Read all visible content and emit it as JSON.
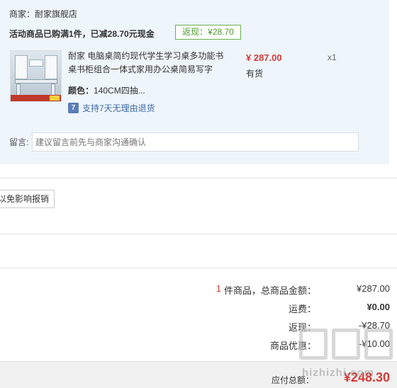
{
  "order": {
    "merchant": "商家：耐家旗舰店",
    "promo": "活动商品已购满1件，已减28.70元现金",
    "rebate_badge": "返现：¥28.70",
    "product": {
      "title": "耐家 电脑桌简约现代学生学习桌多功能书桌书柜组合一体式家用办公桌简易写字",
      "variant_label": "颜色：",
      "variant_value": "140CM四抽...",
      "return_icon": "7",
      "return_text": "支持7天无理由退货",
      "price": "¥ 287.00",
      "stock": "有货",
      "quantity": "x1"
    },
    "note_label": "留言:",
    "note_placeholder": "建议留言前先与商家沟通确认"
  },
  "report_button": "以免影响报销",
  "summary": {
    "count": "1",
    "count_label": "件商品，总商品金额：",
    "goods_total": "¥287.00",
    "shipping_label": "运费：",
    "shipping": "¥0.00",
    "rebate_label": "返现：",
    "rebate": "-¥28.70",
    "discount_label": "商品优惠：",
    "discount": "-¥10.00",
    "payable_label": "应付总额：",
    "payable": "¥248.30"
  },
  "watermark_text": "hizhizhi.com",
  "icons": {
    "return_icon": "seven-day-return-icon",
    "watermark": "site-watermark-logo"
  },
  "colors": {
    "price_red": "#d23b38",
    "rebate_green": "#4e9a2f",
    "order_bg": "#eef5fb"
  }
}
